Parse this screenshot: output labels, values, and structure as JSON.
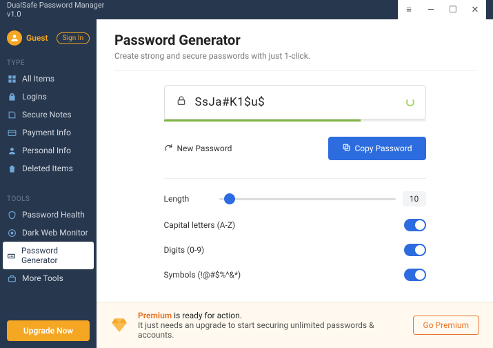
{
  "app": {
    "title": "DualSafe Password Manager",
    "version": "v1.0"
  },
  "user": {
    "name": "Guest",
    "signin_label": "Sign In"
  },
  "sections": {
    "type": "TYPE",
    "tools": "TOOLS"
  },
  "nav": {
    "type": [
      {
        "label": "All Items"
      },
      {
        "label": "Logins"
      },
      {
        "label": "Secure Notes"
      },
      {
        "label": "Payment Info"
      },
      {
        "label": "Personal Info"
      },
      {
        "label": "Deleted Items"
      }
    ],
    "tools": [
      {
        "label": "Password Health"
      },
      {
        "label": "Dark Web Monitor"
      },
      {
        "label": "Password Generator"
      },
      {
        "label": "More Tools"
      }
    ]
  },
  "upgrade_label": "Upgrade Now",
  "page": {
    "title": "Password Generator",
    "subtitle": "Create strong and secure passwords with just 1-click.",
    "password": "SsJa#K1$u$",
    "new_pw_label": "New Password",
    "copy_label": "Copy Password",
    "length_label": "Length",
    "length_value": "10",
    "opt_caps": "Capital letters (A-Z)",
    "opt_digits": "Digits (0-9)",
    "opt_symbols": "Symbols (!@#$%^&*)"
  },
  "premium": {
    "headline_strong": "Premium",
    "headline_rest": " is ready for action.",
    "sub": "It just needs an upgrade to start securing unlimited passwords & accounts.",
    "cta": "Go Premium"
  }
}
